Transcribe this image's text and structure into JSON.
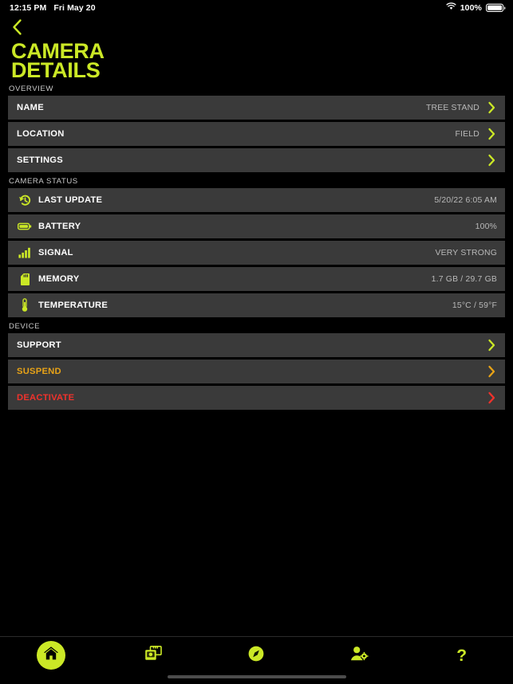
{
  "status_bar": {
    "time": "12:15 PM",
    "date": "Fri May 20",
    "wifi_icon": "wifi-icon",
    "battery_percent": "100%",
    "battery_icon": "battery-full-icon"
  },
  "header": {
    "back_icon": "chevron-left-icon",
    "title_line1": "CAMERA",
    "title_line2": "DETAILS",
    "accent_color": "#cbe826"
  },
  "sections": [
    {
      "label": "OVERVIEW",
      "rows": [
        {
          "label": "NAME",
          "value": "TREE STAND",
          "chevron": "chevron-right-icon",
          "chevron_color": "#cbe826",
          "icon": null
        },
        {
          "label": "LOCATION",
          "value": "FIELD",
          "chevron": "chevron-right-icon",
          "chevron_color": "#cbe826",
          "icon": null
        },
        {
          "label": "SETTINGS",
          "value": "",
          "chevron": "chevron-right-icon",
          "chevron_color": "#cbe826",
          "icon": null
        }
      ]
    },
    {
      "label": "CAMERA STATUS",
      "rows": [
        {
          "label": "LAST UPDATE",
          "value": "5/20/22 6:05 AM",
          "chevron": null,
          "icon": "history-clock-icon"
        },
        {
          "label": "BATTERY",
          "value": "100%",
          "chevron": null,
          "icon": "battery-icon"
        },
        {
          "label": "SIGNAL",
          "value": "VERY STRONG",
          "chevron": null,
          "icon": "signal-bars-icon"
        },
        {
          "label": "MEMORY",
          "value": "1.7 GB / 29.7 GB",
          "chevron": null,
          "icon": "sd-card-icon"
        },
        {
          "label": "TEMPERATURE",
          "value": "15°C / 59°F",
          "chevron": null,
          "icon": "thermometer-icon"
        }
      ]
    },
    {
      "label": "DEVICE",
      "rows": [
        {
          "label": "SUPPORT",
          "value": "",
          "chevron": "chevron-right-icon",
          "chevron_color": "#cbe826",
          "label_color": "#ffffff",
          "icon": null
        },
        {
          "label": "SUSPEND",
          "value": "",
          "chevron": "chevron-right-icon",
          "chevron_color": "#e8a317",
          "label_color": "#e8a317",
          "icon": null
        },
        {
          "label": "DEACTIVATE",
          "value": "",
          "chevron": "chevron-right-icon",
          "chevron_color": "#f0322c",
          "label_color": "#f0322c",
          "icon": null
        }
      ]
    }
  ],
  "tabbar": {
    "items": [
      {
        "name": "home",
        "icon": "home-icon",
        "active": true
      },
      {
        "name": "gallery",
        "icon": "photo-stack-icon",
        "active": false
      },
      {
        "name": "map",
        "icon": "compass-icon",
        "active": false
      },
      {
        "name": "account",
        "icon": "user-settings-icon",
        "active": false
      },
      {
        "name": "help",
        "icon": "question-mark-icon",
        "active": false,
        "glyph": "?"
      }
    ]
  }
}
